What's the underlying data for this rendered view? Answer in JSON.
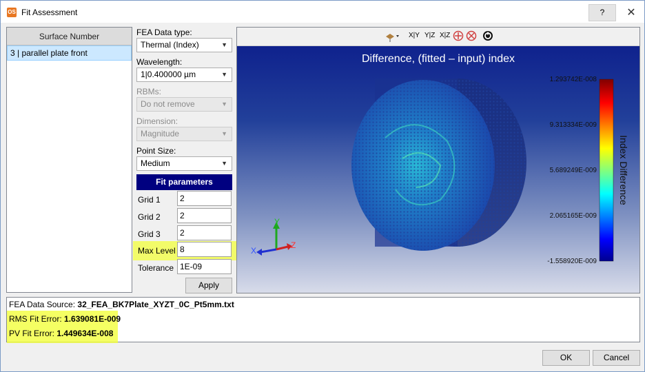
{
  "window": {
    "icon_text": "OS",
    "title": "Fit Assessment",
    "help_label": "?",
    "close_label": "✕"
  },
  "surface_list": {
    "header": "Surface Number",
    "items": [
      "3 | parallel plate front"
    ]
  },
  "controls": {
    "fea_data_type": {
      "label": "FEA Data type:",
      "value": "Thermal (Index)"
    },
    "wavelength": {
      "label": "Wavelength:",
      "value": "1|0.400000 µm"
    },
    "rbms": {
      "label": "RBMs:",
      "value": "Do not remove"
    },
    "dimension": {
      "label": "Dimension:",
      "value": "Magnitude"
    },
    "point_size": {
      "label": "Point Size:",
      "value": "Medium"
    }
  },
  "fit_parameters": {
    "header": "Fit parameters",
    "grid1": {
      "label": "Grid 1",
      "value": "2"
    },
    "grid2": {
      "label": "Grid 2",
      "value": "2"
    },
    "grid3": {
      "label": "Grid 3",
      "value": "2"
    },
    "max_level": {
      "label": "Max Level",
      "value": "8"
    },
    "tolerance": {
      "label": "Tolerance",
      "value": "1E-09"
    },
    "apply_label": "Apply"
  },
  "viewer": {
    "toolbar": {
      "xy": "X|Y",
      "yz": "Y|Z",
      "xz": "X|Z"
    },
    "title": "Difference, (fitted – input) index",
    "colorbar": {
      "label": "Index Difference",
      "ticks": [
        "1.293742E-008",
        "9.313334E-009",
        "5.689249E-009",
        "2.065165E-009",
        "-1.558920E-009"
      ]
    },
    "axes": {
      "x": "X",
      "y": "Y",
      "z": "Z"
    }
  },
  "status": {
    "source_label": "FEA Data Source:",
    "source_value": "32_FEA_BK7Plate_XYZT_0C_Pt5mm.txt",
    "rms_label": "RMS Fit Error:",
    "rms_value": "1.639081E-009",
    "pv_label": "PV Fit Error:",
    "pv_value": "1.449634E-008"
  },
  "buttons": {
    "ok": "OK",
    "cancel": "Cancel"
  }
}
